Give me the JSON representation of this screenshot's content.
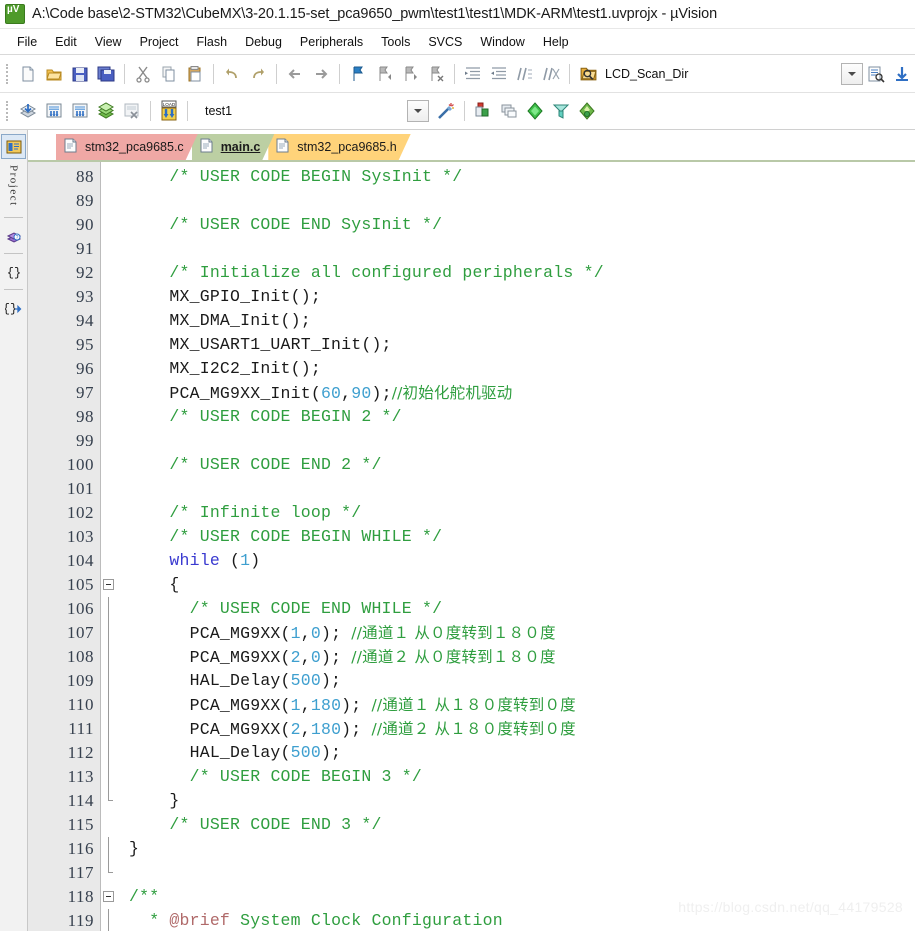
{
  "window": {
    "title": "A:\\Code base\\2-STM32\\CubeMX\\3-20.1.15-set_pca9650_pwm\\test1\\test1\\MDK-ARM\\test1.uvprojx - µVision",
    "app_icon": "uvision-icon"
  },
  "menu": {
    "items": [
      {
        "label": "File"
      },
      {
        "label": "Edit"
      },
      {
        "label": "View"
      },
      {
        "label": "Project"
      },
      {
        "label": "Flash"
      },
      {
        "label": "Debug"
      },
      {
        "label": "Peripherals"
      },
      {
        "label": "Tools"
      },
      {
        "label": "SVCS"
      },
      {
        "label": "Window"
      },
      {
        "label": "Help"
      }
    ]
  },
  "toolbar1": {
    "find_target": "LCD_Scan_Dir",
    "icons": [
      "new-file-icon",
      "open-file-icon",
      "save-icon",
      "save-all-icon",
      "cut-icon",
      "copy-icon",
      "paste-icon",
      "undo-icon",
      "redo-icon",
      "navigate-back-icon",
      "navigate-forward-icon",
      "bookmark-toggle-icon",
      "bookmark-prev-icon",
      "bookmark-next-icon",
      "bookmark-clear-icon",
      "indent-icon",
      "outdent-icon",
      "comment-icon",
      "uncomment-icon",
      "find-in-files-icon"
    ],
    "right_icons": [
      "combo-dropdown-icon",
      "bookmark-find-icon",
      "insert-icon"
    ]
  },
  "toolbar2": {
    "project_name": "test1",
    "icons": [
      "translate-icon",
      "build-icon",
      "rebuild-icon",
      "batch-build-icon",
      "stop-build-icon",
      "load-icon"
    ],
    "right_icons": [
      "combo-dropdown-icon",
      "magic-wand-icon",
      "target-options-icon",
      "manage-components-icon",
      "pack-installer-icon",
      "pack-filter-icon",
      "pack-manager-icon"
    ]
  },
  "leftdock": {
    "label": "Project",
    "items": [
      {
        "name": "project-window-icon",
        "active": true
      },
      {
        "name": "books-window-icon",
        "active": false
      },
      {
        "name": "functions-window-icon",
        "active": false
      },
      {
        "name": "templates-window-icon",
        "active": false
      }
    ]
  },
  "tabs": [
    {
      "label": "stm32_pca9685.c",
      "color": "red",
      "active": false,
      "icon": "c-file-icon"
    },
    {
      "label": "main.c",
      "color": "green",
      "active": true,
      "icon": "c-file-icon"
    },
    {
      "label": "stm32_pca9685.h",
      "color": "yellow",
      "active": false,
      "icon": "h-file-icon"
    }
  ],
  "editor": {
    "first_line": 88,
    "lines": [
      {
        "n": 88,
        "fold": "none",
        "tokens": [
          {
            "t": "    ",
            "c": "plain"
          },
          {
            "t": "/* USER CODE BEGIN SysInit */",
            "c": "comment"
          }
        ]
      },
      {
        "n": 89,
        "fold": "none",
        "tokens": []
      },
      {
        "n": 90,
        "fold": "none",
        "tokens": [
          {
            "t": "    ",
            "c": "plain"
          },
          {
            "t": "/* USER CODE END SysInit */",
            "c": "comment"
          }
        ]
      },
      {
        "n": 91,
        "fold": "none",
        "tokens": []
      },
      {
        "n": 92,
        "fold": "none",
        "tokens": [
          {
            "t": "    ",
            "c": "plain"
          },
          {
            "t": "/* Initialize all configured peripherals */",
            "c": "comment"
          }
        ]
      },
      {
        "n": 93,
        "fold": "none",
        "tokens": [
          {
            "t": "    MX_GPIO_Init();",
            "c": "plain"
          }
        ]
      },
      {
        "n": 94,
        "fold": "none",
        "tokens": [
          {
            "t": "    MX_DMA_Init();",
            "c": "plain"
          }
        ]
      },
      {
        "n": 95,
        "fold": "none",
        "tokens": [
          {
            "t": "    MX_USART1_UART_Init();",
            "c": "plain"
          }
        ]
      },
      {
        "n": 96,
        "fold": "none",
        "tokens": [
          {
            "t": "    MX_I2C2_Init();",
            "c": "plain"
          }
        ]
      },
      {
        "n": 97,
        "fold": "none",
        "tokens": [
          {
            "t": "    PCA_MG9XX_Init(",
            "c": "plain"
          },
          {
            "t": "60",
            "c": "num"
          },
          {
            "t": ",",
            "c": "plain"
          },
          {
            "t": "90",
            "c": "num"
          },
          {
            "t": ");",
            "c": "plain"
          },
          {
            "t": "//初始化舵机驱动",
            "c": "comment-cjk"
          }
        ]
      },
      {
        "n": 98,
        "fold": "none",
        "tokens": [
          {
            "t": "    ",
            "c": "plain"
          },
          {
            "t": "/* USER CODE BEGIN 2 */",
            "c": "comment"
          }
        ]
      },
      {
        "n": 99,
        "fold": "none",
        "tokens": []
      },
      {
        "n": 100,
        "fold": "none",
        "tokens": [
          {
            "t": "    ",
            "c": "plain"
          },
          {
            "t": "/* USER CODE END 2 */",
            "c": "comment"
          }
        ]
      },
      {
        "n": 101,
        "fold": "none",
        "tokens": []
      },
      {
        "n": 102,
        "fold": "none",
        "tokens": [
          {
            "t": "    ",
            "c": "plain"
          },
          {
            "t": "/* Infinite loop */",
            "c": "comment"
          }
        ]
      },
      {
        "n": 103,
        "fold": "none",
        "tokens": [
          {
            "t": "    ",
            "c": "plain"
          },
          {
            "t": "/* USER CODE BEGIN WHILE */",
            "c": "comment"
          }
        ]
      },
      {
        "n": 104,
        "fold": "none",
        "tokens": [
          {
            "t": "    ",
            "c": "plain"
          },
          {
            "t": "while",
            "c": "kw"
          },
          {
            "t": " (",
            "c": "plain"
          },
          {
            "t": "1",
            "c": "num"
          },
          {
            "t": ")",
            "c": "plain"
          }
        ]
      },
      {
        "n": 105,
        "fold": "start",
        "tokens": [
          {
            "t": "    {",
            "c": "plain"
          }
        ]
      },
      {
        "n": 106,
        "fold": "mid",
        "tokens": [
          {
            "t": "      ",
            "c": "plain"
          },
          {
            "t": "/* USER CODE END WHILE */",
            "c": "comment"
          }
        ]
      },
      {
        "n": 107,
        "fold": "mid",
        "tokens": [
          {
            "t": "      PCA_MG9XX(",
            "c": "plain"
          },
          {
            "t": "1",
            "c": "num"
          },
          {
            "t": ",",
            "c": "plain"
          },
          {
            "t": "0",
            "c": "num"
          },
          {
            "t": "); ",
            "c": "plain"
          },
          {
            "t": "//通道１ 从０度转到１８０度",
            "c": "comment-cjk"
          }
        ]
      },
      {
        "n": 108,
        "fold": "mid",
        "tokens": [
          {
            "t": "      PCA_MG9XX(",
            "c": "plain"
          },
          {
            "t": "2",
            "c": "num"
          },
          {
            "t": ",",
            "c": "plain"
          },
          {
            "t": "0",
            "c": "num"
          },
          {
            "t": "); ",
            "c": "plain"
          },
          {
            "t": "//通道２ 从０度转到１８０度",
            "c": "comment-cjk"
          }
        ]
      },
      {
        "n": 109,
        "fold": "mid",
        "tokens": [
          {
            "t": "      HAL_Delay(",
            "c": "plain"
          },
          {
            "t": "500",
            "c": "num"
          },
          {
            "t": ");",
            "c": "plain"
          }
        ]
      },
      {
        "n": 110,
        "fold": "mid",
        "tokens": [
          {
            "t": "      PCA_MG9XX(",
            "c": "plain"
          },
          {
            "t": "1",
            "c": "num"
          },
          {
            "t": ",",
            "c": "plain"
          },
          {
            "t": "180",
            "c": "num"
          },
          {
            "t": "); ",
            "c": "plain"
          },
          {
            "t": "//通道１ 从１８０度转到０度",
            "c": "comment-cjk"
          }
        ]
      },
      {
        "n": 111,
        "fold": "mid",
        "tokens": [
          {
            "t": "      PCA_MG9XX(",
            "c": "plain"
          },
          {
            "t": "2",
            "c": "num"
          },
          {
            "t": ",",
            "c": "plain"
          },
          {
            "t": "180",
            "c": "num"
          },
          {
            "t": "); ",
            "c": "plain"
          },
          {
            "t": "//通道２ 从１８０度转到０度",
            "c": "comment-cjk"
          }
        ]
      },
      {
        "n": 112,
        "fold": "mid",
        "tokens": [
          {
            "t": "      HAL_Delay(",
            "c": "plain"
          },
          {
            "t": "500",
            "c": "num"
          },
          {
            "t": ");",
            "c": "plain"
          }
        ]
      },
      {
        "n": 113,
        "fold": "mid",
        "tokens": [
          {
            "t": "      ",
            "c": "plain"
          },
          {
            "t": "/* USER CODE BEGIN 3 */",
            "c": "comment"
          }
        ]
      },
      {
        "n": 114,
        "fold": "end",
        "tokens": [
          {
            "t": "    }",
            "c": "plain"
          }
        ]
      },
      {
        "n": 115,
        "fold": "none",
        "tokens": [
          {
            "t": "    ",
            "c": "plain"
          },
          {
            "t": "/* USER CODE END 3 */",
            "c": "comment"
          }
        ]
      },
      {
        "n": 116,
        "fold": "outer-mid",
        "tokens": [
          {
            "t": "}",
            "c": "plain"
          }
        ]
      },
      {
        "n": 117,
        "fold": "outer-end",
        "tokens": []
      },
      {
        "n": 118,
        "fold": "start",
        "tokens": [
          {
            "t": "/**",
            "c": "comment"
          }
        ]
      },
      {
        "n": 119,
        "fold": "mid",
        "tokens": [
          {
            "t": "  * ",
            "c": "comment"
          },
          {
            "t": "@brief",
            "c": "brief"
          },
          {
            "t": " System Clock Configuration",
            "c": "comment"
          }
        ]
      }
    ]
  },
  "watermark": {
    "text": "https://blog.csdn.net/qq_44179528"
  }
}
